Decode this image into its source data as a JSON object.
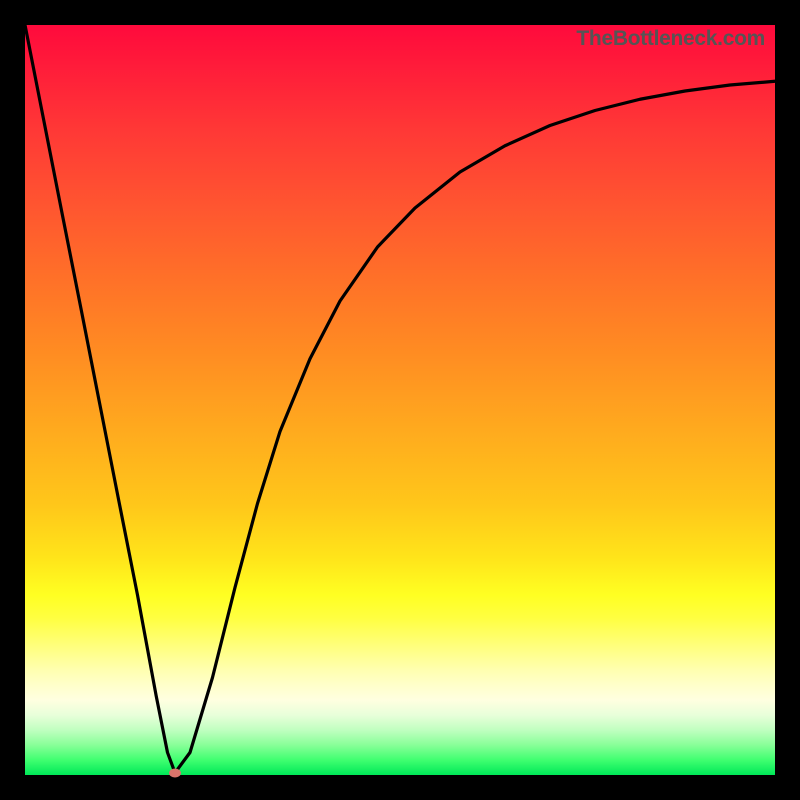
{
  "watermark": "TheBottleneck.com",
  "chart_data": {
    "type": "line",
    "title": "",
    "xlabel": "",
    "ylabel": "",
    "x_range": [
      0,
      100
    ],
    "y_range": [
      0,
      100
    ],
    "gradient_colors": {
      "top": "#ff0a3c",
      "mid_upper": "#ff8d22",
      "mid_lower": "#ffe41a",
      "bottom": "#00e858"
    },
    "series": [
      {
        "name": "bottleneck-curve",
        "x": [
          0.0,
          2.5,
          5.0,
          7.5,
          10.0,
          12.5,
          15.0,
          17.5,
          19.0,
          20.0,
          22.0,
          25.0,
          28.0,
          31.0,
          34.0,
          38.0,
          42.0,
          47.0,
          52.0,
          58.0,
          64.0,
          70.0,
          76.0,
          82.0,
          88.0,
          94.0,
          100.0
        ],
        "y": [
          100.0,
          87.3,
          74.6,
          62.0,
          49.3,
          36.6,
          24.0,
          10.5,
          3.0,
          0.3,
          3.0,
          13.0,
          25.0,
          36.2,
          45.8,
          55.5,
          63.2,
          70.4,
          75.6,
          80.4,
          83.9,
          86.6,
          88.6,
          90.1,
          91.2,
          92.0,
          92.5
        ]
      }
    ],
    "marker": {
      "x": 20.0,
      "y": 0.3,
      "color": "#d9746b"
    },
    "annotations": []
  }
}
